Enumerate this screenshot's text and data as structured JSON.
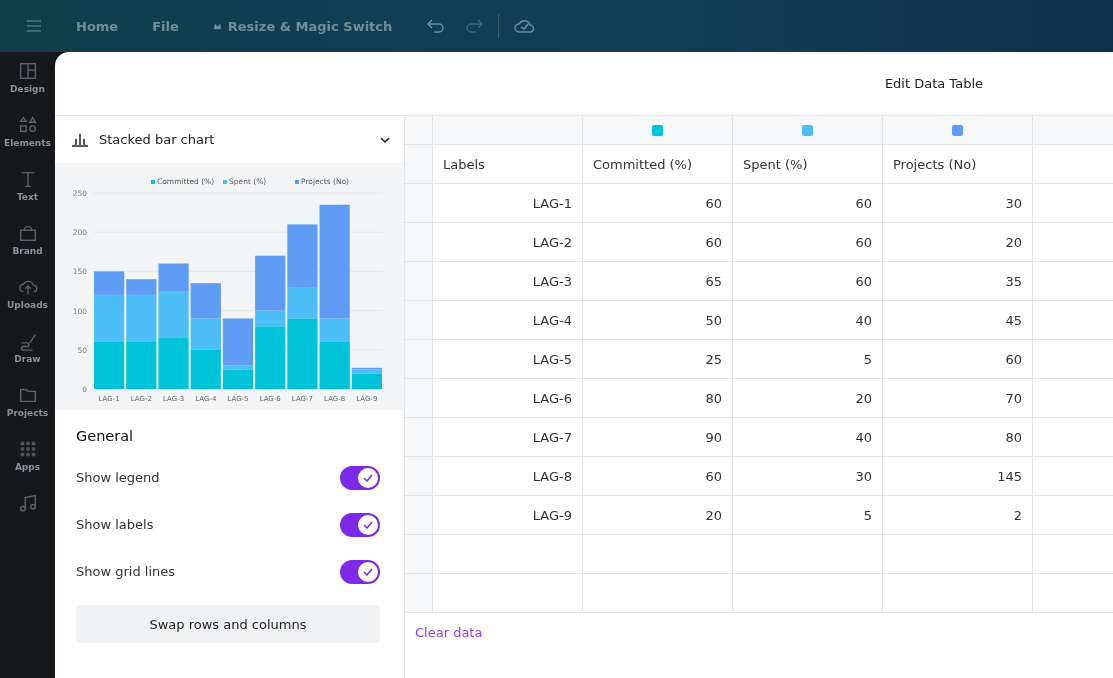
{
  "top_bar": {
    "items": [
      "Home",
      "File",
      "Resize & Magic Switch"
    ]
  },
  "sidebar": {
    "items": [
      {
        "label": "Design"
      },
      {
        "label": "Elements"
      },
      {
        "label": "Text"
      },
      {
        "label": "Brand"
      },
      {
        "label": "Uploads"
      },
      {
        "label": "Draw"
      },
      {
        "label": "Projects"
      },
      {
        "label": "Apps"
      }
    ]
  },
  "dialog": {
    "title": "Edit Data Table"
  },
  "chart_picker": {
    "value": "Stacked bar chart"
  },
  "chart": {
    "chart_data": {
      "type": "bar",
      "stacked": true,
      "grid": true,
      "legend": true,
      "categories": [
        "LAG-1",
        "LAG-2",
        "LAG-3",
        "LAG-4",
        "LAG-5",
        "LAG-6",
        "LAG-7",
        "LAG-8",
        "LAG-9"
      ],
      "series": [
        {
          "name": "Committed (%)",
          "color": "#00c4d9",
          "values": [
            60,
            60,
            65,
            50,
            25,
            80,
            90,
            60,
            20
          ]
        },
        {
          "name": "Spent (%)",
          "color": "#4cbdf7",
          "values": [
            60,
            60,
            60,
            40,
            5,
            20,
            40,
            30,
            5
          ]
        },
        {
          "name": "Projects (No)",
          "color": "#5f9cf5",
          "values": [
            30,
            20,
            35,
            45,
            60,
            70,
            80,
            145,
            2
          ]
        }
      ],
      "ylim": [
        0,
        250
      ],
      "yticks": [
        0,
        50,
        100,
        150,
        200,
        250
      ]
    }
  },
  "general": {
    "title": "General",
    "settings": [
      {
        "label": "Show legend",
        "on": true
      },
      {
        "label": "Show labels",
        "on": true
      },
      {
        "label": "Show grid lines",
        "on": true
      }
    ],
    "swap_button": "Swap rows and columns"
  },
  "table": {
    "columns": [
      "Labels",
      "Committed (%)",
      "Spent (%)",
      "Projects (No)"
    ],
    "rows": [
      [
        "LAG-1",
        "60",
        "60",
        "30"
      ],
      [
        "LAG-2",
        "60",
        "60",
        "20"
      ],
      [
        "LAG-3",
        "65",
        "60",
        "35"
      ],
      [
        "LAG-4",
        "50",
        "40",
        "45"
      ],
      [
        "LAG-5",
        "25",
        "5",
        "60"
      ],
      [
        "LAG-6",
        "80",
        "20",
        "70"
      ],
      [
        "LAG-7",
        "90",
        "40",
        "80"
      ],
      [
        "LAG-8",
        "60",
        "30",
        "145"
      ],
      [
        "LAG-9",
        "20",
        "5",
        "2"
      ]
    ]
  },
  "clear_link": "Clear data"
}
